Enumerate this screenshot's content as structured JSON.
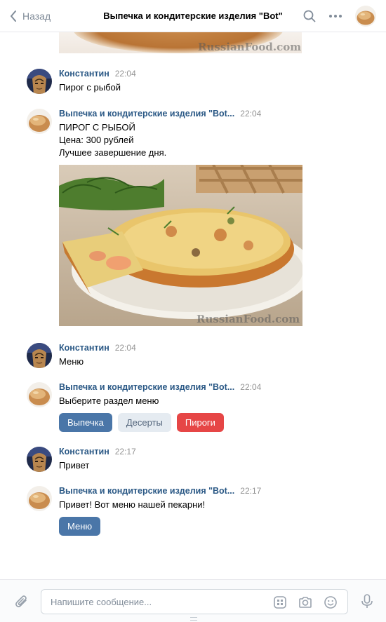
{
  "header": {
    "back_label": "Назад",
    "title": "Выпечка и кондитерские изделия \"Bot\""
  },
  "watermark": "RussianFood.com",
  "messages": [
    {
      "author": "Константин",
      "time": "22:04",
      "lines": [
        "Пирог с рыбой"
      ]
    },
    {
      "author": "Выпечка и кондитерские изделия \"Bot...",
      "time": "22:04",
      "lines": [
        "ПИРОГ С РЫБОЙ",
        "Цена: 300 рублей",
        "Лучшее завершение дня."
      ]
    },
    {
      "author": "Константин",
      "time": "22:04",
      "lines": [
        "Меню"
      ]
    },
    {
      "author": "Выпечка и кондитерские изделия \"Bot...",
      "time": "22:04",
      "lines": [
        "Выберите раздел меню"
      ],
      "buttons": [
        "Выпечка",
        "Десерты",
        "Пироги"
      ]
    },
    {
      "author": "Константин",
      "time": "22:17",
      "lines": [
        "Привет"
      ]
    },
    {
      "author": "Выпечка и кондитерские изделия \"Bot...",
      "time": "22:17",
      "lines": [
        "Привет! Вот меню нашей пекарни!"
      ],
      "buttons": [
        "Меню"
      ]
    }
  ],
  "composer": {
    "placeholder": "Напишите сообщение..."
  },
  "colors": {
    "accent": "#4a76a8",
    "author": "#2a5885",
    "negative": "#e64646",
    "secondary": "#e5ebf1"
  },
  "icons": [
    "chevron-left-icon",
    "search-icon",
    "more-icon",
    "attach-icon",
    "keyboard-icon",
    "camera-icon",
    "emoji-icon",
    "microphone-icon"
  ]
}
